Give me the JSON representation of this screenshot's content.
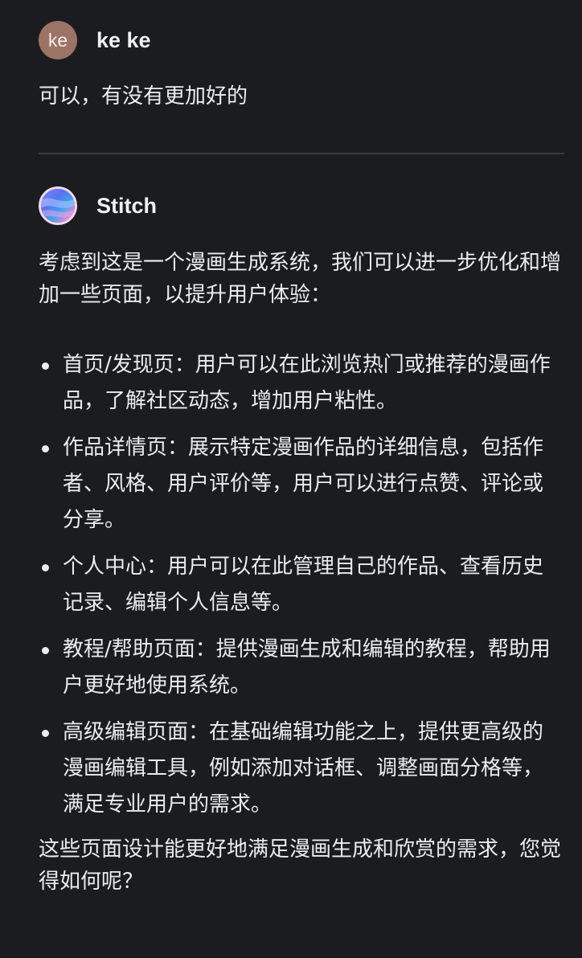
{
  "user_message": {
    "avatar_initials": "ke",
    "name": "ke ke",
    "text": "可以，有没有更加好的"
  },
  "assistant_message": {
    "avatar_icon": "gradient-orb-icon",
    "name": "Stitch",
    "intro": "考虑到这是一个漫画生成系统，我们可以进一步优化和增加一些页面，以提升用户体验：",
    "bullets": [
      "首页/发现页：用户可以在此浏览热门或推荐的漫画作品，了解社区动态，增加用户粘性。",
      "作品详情页：展示特定漫画作品的详细信息，包括作者、风格、用户评价等，用户可以进行点赞、评论或分享。",
      "个人中心：用户可以在此管理自己的作品、查看历史记录、编辑个人信息等。",
      "教程/帮助页面：提供漫画生成和编辑的教程，帮助用户更好地使用系统。",
      "高级编辑页面：在基础编辑功能之上，提供更高级的漫画编辑工具，例如添加对话框、调整画面分格等，满足专业用户的需求。"
    ],
    "closing": "这些页面设计能更好地满足漫画生成和欣赏的需求，您觉得如何呢？"
  },
  "colors": {
    "background": "#1b1c20",
    "text": "#ececef",
    "user_avatar": "#9b7466",
    "divider": "#3a3b41"
  }
}
